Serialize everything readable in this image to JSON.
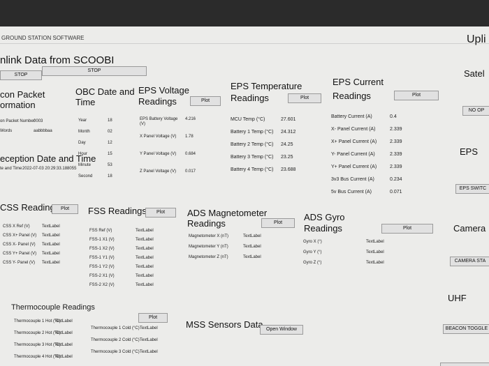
{
  "app": {
    "title": "GROUND STATION SOFTWARE"
  },
  "downlink": {
    "title": "nlink Data from SCOOBI",
    "stop_left": "STOP",
    "stop_right": "STOP"
  },
  "beacon": {
    "title_l1": "con Packet",
    "title_l2": "ormation",
    "packet_number_label": "on Packet Number",
    "packet_number": "0003",
    "words_label": "Words",
    "words": "aabbbbaa"
  },
  "reception": {
    "title": "eception Date and Time",
    "label": "te and Time",
    "value": "2022-07-03 20:29:33.188055"
  },
  "obc": {
    "title_l1": "OBC Date and",
    "title_l2": "Time",
    "rows": [
      {
        "label": "Year",
        "value": "18"
      },
      {
        "label": "Month",
        "value": "02"
      },
      {
        "label": "Day",
        "value": "12"
      },
      {
        "label": "Hour",
        "value": "15"
      },
      {
        "label": "Minute",
        "value": "53"
      },
      {
        "label": "Second",
        "value": "18"
      }
    ]
  },
  "eps_voltage": {
    "title_l1": "EPS Voltage",
    "title_l2": "Readings",
    "plot": "Plot",
    "rows": [
      {
        "label": "EPS Battery Voltage (V)",
        "value": "4.216"
      },
      {
        "label": "X Panel Voltage (V)",
        "value": "1.78"
      },
      {
        "label": "Y Panel Voltage (V)",
        "value": "0.684"
      },
      {
        "label": "Z Panel Voltage (V)",
        "value": "0.017"
      }
    ]
  },
  "eps_temp": {
    "title_l1": "EPS Temperature",
    "title_l2": "Readings",
    "plot": "Plot",
    "rows": [
      {
        "label": "MCU Temp (°C)",
        "value": "27.601"
      },
      {
        "label": "Battery 1 Temp (°C)",
        "value": "24.312"
      },
      {
        "label": "Battery 2 Temp (°C)",
        "value": "24.25"
      },
      {
        "label": "Battery 3 Temp (°C)",
        "value": "23.25"
      },
      {
        "label": "Battery 4 Temp (°C)",
        "value": "23.688"
      }
    ]
  },
  "eps_current": {
    "title_l1": "EPS Current",
    "title_l2": "Readings",
    "plot": "Plot",
    "rows": [
      {
        "label": "Battery Current (A)",
        "value": "0.4"
      },
      {
        "label": "X- Panel Current (A)",
        "value": "2.339"
      },
      {
        "label": "X+ Panel Current (A)",
        "value": "2.339"
      },
      {
        "label": "Y- Panel Current (A)",
        "value": "2.339"
      },
      {
        "label": "Y+ Panel Current (A)",
        "value": "2.339"
      },
      {
        "label": "3v3 Bus Current (A)",
        "value": "0.234"
      },
      {
        "label": "5v Bus Current (A)",
        "value": "0.071"
      }
    ]
  },
  "right_panel": {
    "title": "Upli",
    "satel": "Satel",
    "no_op": "NO OP",
    "eps": "EPS",
    "eps_switch": "EPS SWITC",
    "camera": "Camera",
    "camera_btn": "CAMERA STA",
    "uhf": "UHF",
    "beacon_toggle": "BEACON TOGGLE"
  },
  "css": {
    "title": "CSS Readings",
    "plot": "Plot",
    "rows": [
      {
        "label": "CSS X Ref (V)",
        "value": "TextLabel"
      },
      {
        "label": "CSS X+ Panel (V)",
        "value": "TextLabel"
      },
      {
        "label": "CSS X- Panel (V)",
        "value": "TextLabel"
      },
      {
        "label": "CSS Y+ Panel (V)",
        "value": "TextLabel"
      },
      {
        "label": "CSS Y- Panel (V)",
        "value": "TextLabel"
      }
    ]
  },
  "fss": {
    "title": "FSS Readings",
    "plot": "Plot",
    "rows": [
      {
        "label": "FSS Ref (V)",
        "value": "TextLabel"
      },
      {
        "label": "FSS-1 X1 (V)",
        "value": "TextLabel"
      },
      {
        "label": "FSS-1 X2 (V)",
        "value": "TextLabel"
      },
      {
        "label": "FSS-1 Y1 (V)",
        "value": "TextLabel"
      },
      {
        "label": "FSS-1 Y2 (V)",
        "value": "TextLabel"
      },
      {
        "label": "FSS-2 X1 (V)",
        "value": "TextLabel"
      },
      {
        "label": "FSS-2 X2 (V)",
        "value": "TextLabel"
      }
    ]
  },
  "ads_mag": {
    "title_l1": "ADS Magnetometer",
    "title_l2": "Readings",
    "plot": "Plot",
    "rows": [
      {
        "label": "Magnetometer X (nT)",
        "value": "TextLabel"
      },
      {
        "label": "Magnetometer Y (nT)",
        "value": "TextLabel"
      },
      {
        "label": "Magnetometer Z (nT)",
        "value": "TextLabel"
      }
    ]
  },
  "ads_gyro": {
    "title_l1": "ADS Gyro",
    "title_l2": "Readings",
    "plot": "Plot",
    "rows": [
      {
        "label": "Gyro X (°)",
        "value": "TextLabel"
      },
      {
        "label": "Gyro Y (°)",
        "value": "TextLabel"
      },
      {
        "label": "Gyro Z (°)",
        "value": "TextLabel"
      }
    ]
  },
  "thermo": {
    "title": "Thermocouple Readings",
    "plot": "Plot",
    "left_rows": [
      {
        "label": "Thermocouple 1 Hot (°C)",
        "value": "TextLabel"
      },
      {
        "label": "Thermocouple 2 Hot (°C)",
        "value": "TextLabel"
      },
      {
        "label": "Thermocouple 3 Hot (°C)",
        "value": "TextLabel"
      },
      {
        "label": "Thermocouple 4 Hot (°C)",
        "value": "TextLabel"
      }
    ],
    "right_rows": [
      {
        "label": "Thermocouple 1 Cold (°C)",
        "value": "TextLabel"
      },
      {
        "label": "Thermocouple 2 Cold (°C)",
        "value": "TextLabel"
      },
      {
        "label": "Thermocouple 3 Cold (°C)",
        "value": "TextLabel"
      }
    ]
  },
  "mss": {
    "title": "MSS Sensors Data",
    "open_window": "Open Window"
  }
}
